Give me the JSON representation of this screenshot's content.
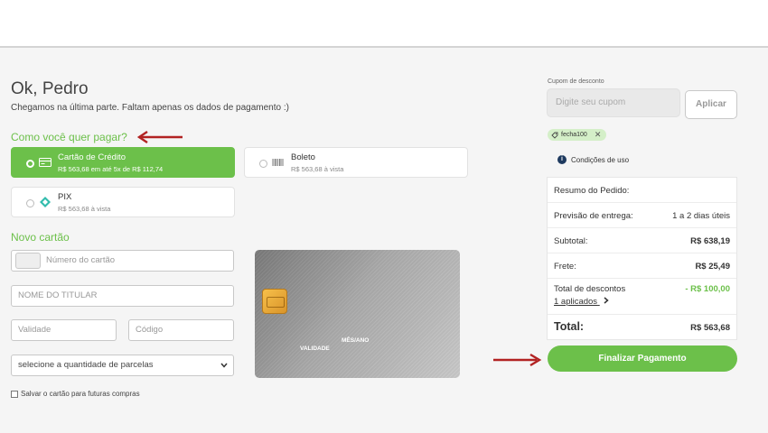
{
  "greeting": "Ok, Pedro",
  "subtitle": "Chegamos na última parte. Faltam apenas os dados de pagamento :)",
  "payment": {
    "question": "Como você quer pagar?",
    "options": [
      {
        "name": "Cartão de Crédito",
        "detail": "R$ 563,68 em até 5x de R$ 112,74",
        "icon": "credit-card-icon"
      },
      {
        "name": "Boleto",
        "detail": "R$ 563,68 à vista",
        "icon": "barcode-icon"
      },
      {
        "name": "PIX",
        "detail": "R$ 563,68 à vista",
        "icon": "pix-icon"
      }
    ]
  },
  "new_card": {
    "title": "Novo cartão",
    "number_placeholder": "Número do cartão",
    "holder_placeholder": "NOME DO TITULAR",
    "expiry_placeholder": "Validade",
    "code_placeholder": "Código",
    "installments": "selecione a quantidade de parcelas",
    "save_label": "Salvar o cartão para futuras compras"
  },
  "card_preview": {
    "validity": "VALIDADE",
    "month_year": "MÊS/ANO"
  },
  "coupon": {
    "label": "Cupom de desconto",
    "placeholder": "Digite seu cupom",
    "apply": "Aplicar",
    "applied_tag": "fecha100",
    "terms": "Condições de uso"
  },
  "summary": {
    "title": "Resumo do Pedido:",
    "delivery_label": "Previsão de entrega:",
    "delivery_value": "1 a 2 dias úteis",
    "subtotal_label": "Subtotal:",
    "subtotal_value": "R$ 638,19",
    "shipping_label": "Frete:",
    "shipping_value": "R$ 25,49",
    "discount_label": "Total de descontos",
    "discount_value": "- R$ 100,00",
    "discount_link": "1 aplicados",
    "total_label": "Total:",
    "total_value": "R$ 563,68"
  },
  "finalize": "Finalizar Pagamento",
  "colors": {
    "accent": "#6cc04a",
    "arrow": "#b22222"
  }
}
